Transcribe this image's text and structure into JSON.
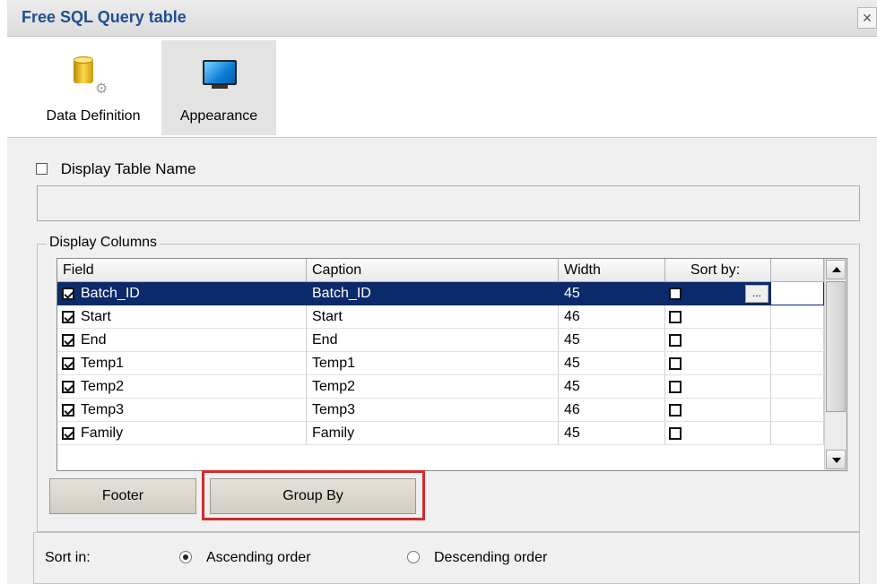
{
  "window": {
    "title": "Free SQL Query table",
    "close_glyph": "×"
  },
  "ribbon": {
    "tabs": [
      {
        "label": "Data Definition",
        "icon": "database-gear-icon",
        "active": false
      },
      {
        "label": "Appearance",
        "icon": "monitor-icon",
        "active": true
      }
    ]
  },
  "display_table_name": {
    "label": "Display Table Name",
    "checked": false,
    "value": ""
  },
  "display_columns": {
    "legend": "Display Columns",
    "headers": [
      "Field",
      "Caption",
      "Width",
      "Sort by:"
    ],
    "rows": [
      {
        "checked": true,
        "field": "Batch_ID",
        "caption": "Batch_ID",
        "width": "45",
        "sort": false,
        "selected": true
      },
      {
        "checked": true,
        "field": "Start",
        "caption": "Start",
        "width": "46",
        "sort": false,
        "selected": false
      },
      {
        "checked": true,
        "field": "End",
        "caption": "End",
        "width": "45",
        "sort": false,
        "selected": false
      },
      {
        "checked": true,
        "field": "Temp1",
        "caption": "Temp1",
        "width": "45",
        "sort": false,
        "selected": false
      },
      {
        "checked": true,
        "field": "Temp2",
        "caption": "Temp2",
        "width": "45",
        "sort": false,
        "selected": false
      },
      {
        "checked": true,
        "field": "Temp3",
        "caption": "Temp3",
        "width": "46",
        "sort": false,
        "selected": false
      },
      {
        "checked": true,
        "field": "Family",
        "caption": "Family",
        "width": "45",
        "sort": false,
        "selected": false
      }
    ],
    "ellipsis": "..."
  },
  "buttons": {
    "footer": "Footer",
    "group_by": "Group By"
  },
  "sort_in": {
    "label": "Sort in:",
    "options": [
      "Ascending order",
      "Descending order"
    ],
    "selected": "Ascending order"
  },
  "colors": {
    "selection": "#0b2a6b",
    "title": "#1f4f8f",
    "highlight": "#d02a2a"
  }
}
